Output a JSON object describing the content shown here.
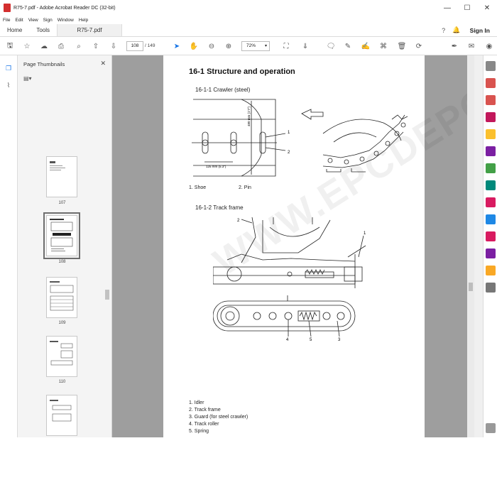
{
  "window": {
    "title": "R75-7.pdf - Adobe Acrobat Reader DC (32-bit)",
    "controls": [
      "—",
      "☐",
      "✕"
    ]
  },
  "menu": [
    "File",
    "Edit",
    "View",
    "Sign",
    "Window",
    "Help"
  ],
  "tabs": {
    "home": "Home",
    "tools": "Tools",
    "document": "R75-7.pdf",
    "signin": "Sign In"
  },
  "toolbar": {
    "current_page": "108",
    "total_pages": "/ 149",
    "zoom": "72%"
  },
  "thumbnails": {
    "title": "Page Thumbnails",
    "pages": [
      "107",
      "108",
      "109",
      "110"
    ]
  },
  "document": {
    "heading": "16-1 Structure and operation",
    "section1": "16-1-1 Crawler (steel)",
    "fig1_labels": [
      "1",
      "2"
    ],
    "fig1_dims": [
      "480 mm (1'7\")",
      "125 mm (5.3\")"
    ],
    "legend1": [
      "1.    Shoe",
      "2.    Pin"
    ],
    "section2": "16-1-2 Track frame",
    "fig2_labels": [
      "2",
      "1",
      "4",
      "5",
      "3"
    ],
    "legend2": [
      "1. Idler",
      "2. Track frame",
      "3. Guard (for steel crawler)",
      "4. Track roller",
      "5. Spring"
    ],
    "watermark": "WWW.EPCDEPO.COM"
  },
  "colors": {
    "accent": "#1473e6",
    "pdf_red": "#d32f2f",
    "doc_bg": "#9e9e9e"
  }
}
